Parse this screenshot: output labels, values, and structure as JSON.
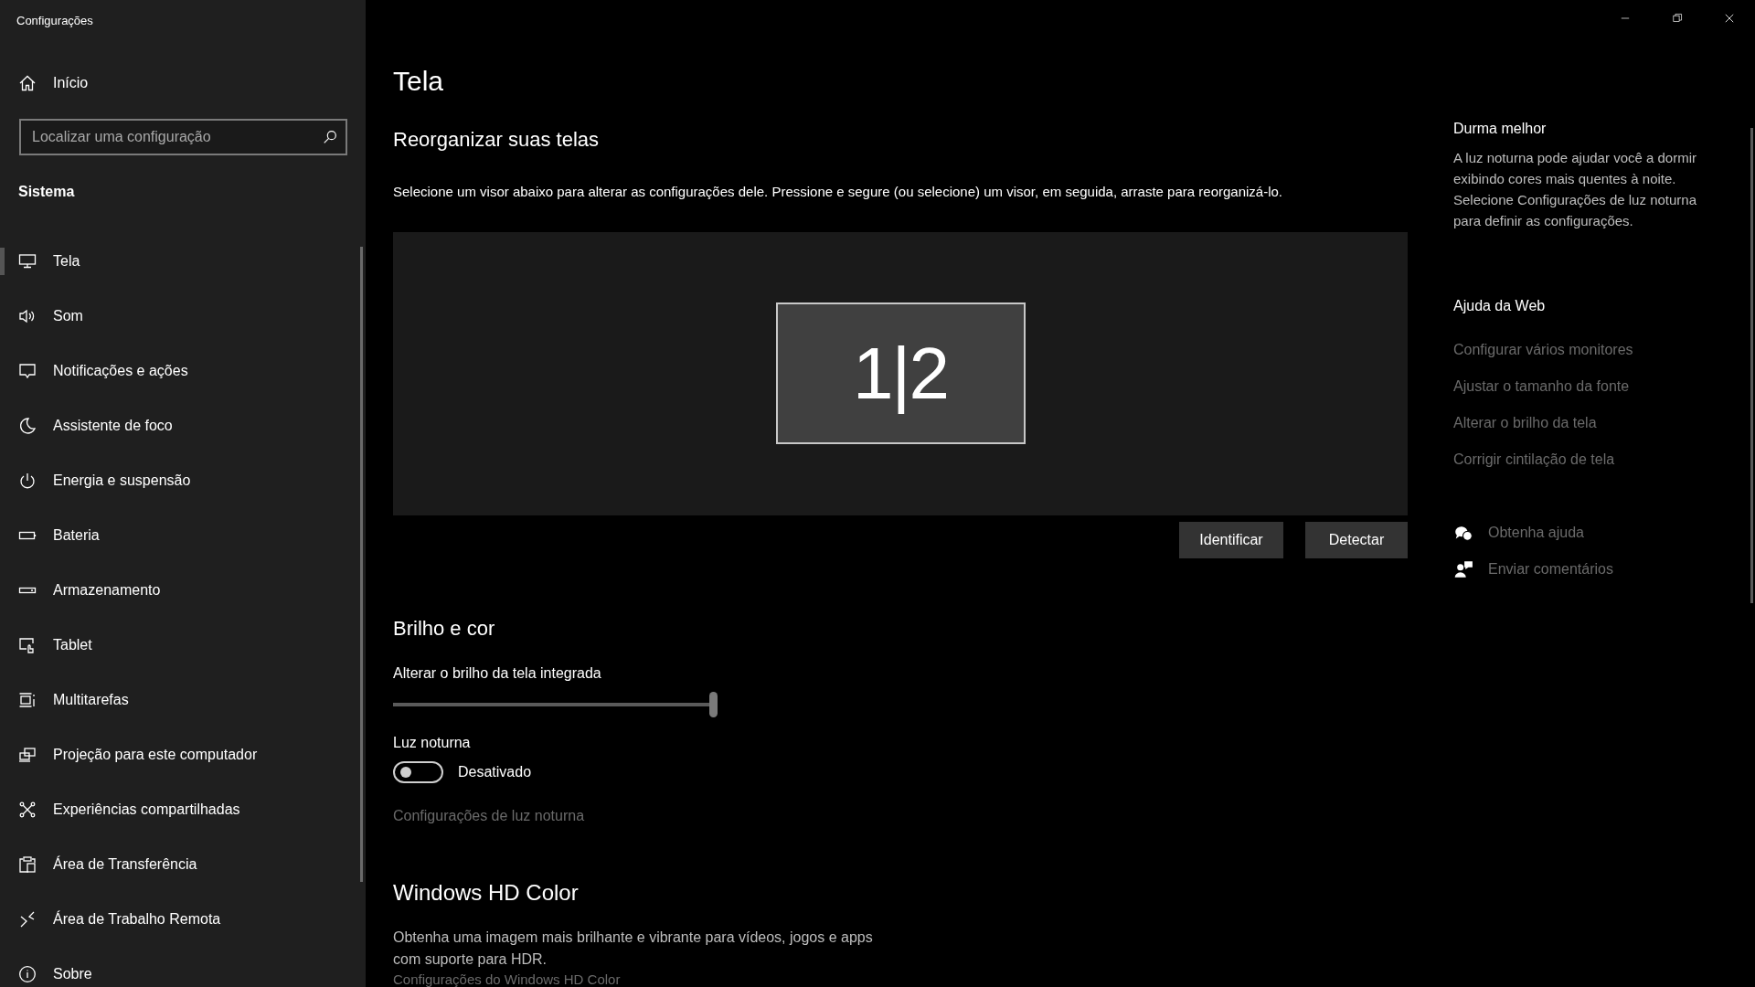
{
  "window": {
    "title": "Configurações"
  },
  "sidebar": {
    "home": "Início",
    "search": {
      "placeholder": "Localizar uma configuração"
    },
    "section": "Sistema",
    "items": [
      {
        "label": "Tela",
        "selected": true
      },
      {
        "label": "Som",
        "selected": false
      },
      {
        "label": "Notificações e ações",
        "selected": false
      },
      {
        "label": "Assistente de foco",
        "selected": false
      },
      {
        "label": "Energia e suspensão",
        "selected": false
      },
      {
        "label": "Bateria",
        "selected": false
      },
      {
        "label": "Armazenamento",
        "selected": false
      },
      {
        "label": "Tablet",
        "selected": false
      },
      {
        "label": "Multitarefas",
        "selected": false
      },
      {
        "label": "Projeção para este computador",
        "selected": false
      },
      {
        "label": "Experiências compartilhadas",
        "selected": false
      },
      {
        "label": "Área de Transferência",
        "selected": false
      },
      {
        "label": "Área de Trabalho Remota",
        "selected": false
      },
      {
        "label": "Sobre",
        "selected": false
      }
    ]
  },
  "page": {
    "title": "Tela",
    "arrange": {
      "heading": "Reorganizar suas telas",
      "description": "Selecione um visor abaixo para alterar as configurações dele. Pressione e segure (ou selecione) um visor, em seguida, arraste para reorganizá-lo.",
      "display_label": "1|2",
      "buttons": [
        "Identificar",
        "Detectar"
      ]
    },
    "brightness": {
      "heading": "Brilho e cor",
      "slider_label": "Alterar o brilho da tela integrada",
      "level": 1.0,
      "night_light_label": "Luz noturna",
      "night_light_on": false,
      "night_light_state": "Desativado",
      "night_light_link": "Configurações de luz noturna"
    },
    "hd_color": {
      "heading": "Windows HD Color",
      "description": "Obtenha uma imagem mais brilhante e vibrante para vídeos, jogos e apps com suporte para HDR.",
      "link": "Configurações do Windows HD Color"
    }
  },
  "aside": {
    "tip_title": "Durma melhor",
    "tip_text": "A luz noturna pode ajudar você a dormir exibindo cores mais quentes à noite. Selecione Configurações de luz noturna para definir as configurações.",
    "help_title": "Ajuda da Web",
    "help_links": [
      "Configurar vários monitores",
      "Ajustar o tamanho da fonte",
      "Alterar o brilho da tela",
      "Corrigir cintilação de tela"
    ],
    "actions": [
      "Obtenha ajuda",
      "Enviar comentários"
    ]
  }
}
